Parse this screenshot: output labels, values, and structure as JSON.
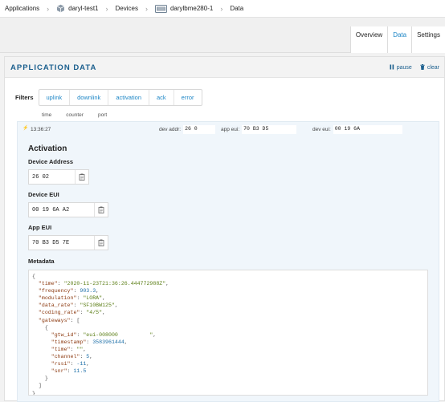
{
  "breadcrumb": {
    "items": [
      "Applications",
      "daryl-test1",
      "Devices",
      "darylbme280-1",
      "Data"
    ]
  },
  "tabs": [
    "Overview",
    "Data",
    "Settings"
  ],
  "panel": {
    "title": "APPLICATION DATA",
    "pause": "pause",
    "clear": "clear"
  },
  "filters": {
    "label": "Filters",
    "buttons": [
      "uplink",
      "downlink",
      "activation",
      "ack",
      "error"
    ],
    "columns": [
      "time",
      "counter",
      "port"
    ]
  },
  "message": {
    "time": "13:36:27",
    "dev_addr_label": "dev addr:",
    "dev_addr": "26 0",
    "app_eui_label": "app eui:",
    "app_eui": "70 B3 D5",
    "dev_eui_label": "dev eui:",
    "dev_eui": "00 19 6A"
  },
  "activation": {
    "title": "Activation",
    "device_address_label": "Device Address",
    "device_address": "26 02",
    "device_eui_label": "Device EUI",
    "device_eui": "00 19 6A A2",
    "app_eui_label": "App EUI",
    "app_eui": "70 B3 D5 7E",
    "metadata_label": "Metadata"
  },
  "metadata": {
    "time": "\"2020-11-23T21:36:26.444772988Z\"",
    "frequency": "903.3",
    "modulation": "\"LORA\"",
    "data_rate": "\"SF10BW125\"",
    "coding_rate": "\"4/5\"",
    "gtw_id": "\"eui-008000          \"",
    "timestamp": "3583961444",
    "gw_time": "\"\"",
    "channel": "5",
    "rssi": "-11",
    "snr": "11.5"
  },
  "colors": {
    "accent": "#1d86c6",
    "title": "#1b5f8e",
    "json_key": "#8c3a10",
    "json_string": "#5b7e16",
    "json_number": "#1d6fa8",
    "message_bg": "#f0f6fb"
  }
}
